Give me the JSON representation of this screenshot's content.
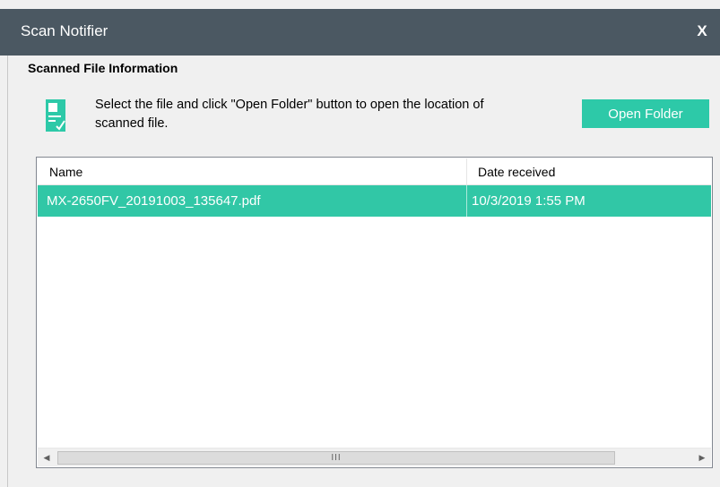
{
  "window": {
    "title": "Scan Notifier",
    "close_label": "X"
  },
  "section": {
    "title": "Scanned File Information"
  },
  "info": {
    "icon": "document-check-icon",
    "text": "Select the file and click \"Open Folder\" button to open the location of scanned file."
  },
  "toolbar": {
    "open_folder_label": "Open Folder"
  },
  "table": {
    "columns": [
      "Name",
      "Date received"
    ],
    "rows": [
      {
        "name": "MX-2650FV_20191003_135647.pdf",
        "date": "10/3/2019 1:55 PM",
        "selected": true
      }
    ]
  },
  "scrollbar": {
    "grip": "III"
  },
  "colors": {
    "titlebar": "#4b5862",
    "accent": "#2dc9a8"
  }
}
